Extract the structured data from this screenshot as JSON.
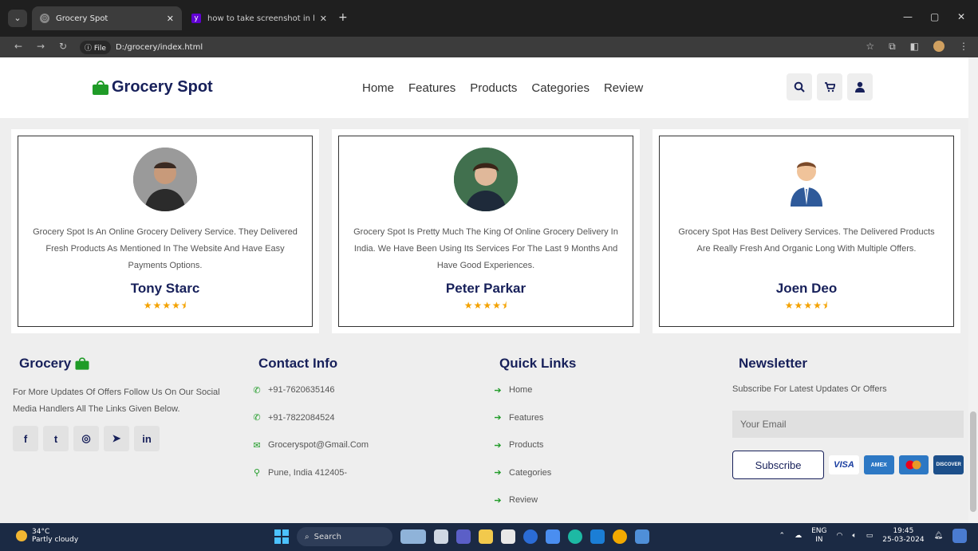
{
  "browser": {
    "tabs": [
      {
        "title": "Grocery Spot",
        "active": true
      },
      {
        "title": "how to take screenshot in lapto",
        "active": false
      }
    ],
    "file_chip": "File",
    "url": "D:/grocery/index.html"
  },
  "header": {
    "logo": "Grocery Spot",
    "nav": [
      "Home",
      "Features",
      "Products",
      "Categories",
      "Review"
    ]
  },
  "reviews": [
    {
      "text": "Grocery Spot Is An Online Grocery Delivery Service. They Delivered Fresh Products As Mentioned In The Website And Have Easy Payments Options.",
      "name": "Tony Starc",
      "rating": 4.5
    },
    {
      "text": "Grocery Spot Is Pretty Much The King Of Online Grocery Delivery In India. We Have Been Using Its Services For The Last 9 Months And Have Good Experiences.",
      "name": "Peter Parkar",
      "rating": 4.5
    },
    {
      "text": "Grocery Spot Has Best Delivery Services. The Delivered Products Are Really Fresh And Organic Long With Multiple Offers.",
      "name": "Joen Deo",
      "rating": 4.5
    }
  ],
  "footer": {
    "brand": {
      "title": "Grocery",
      "text": "For More Updates Of Offers Follow Us On Our Social Media Handlers All The Links Given Below.",
      "socials": [
        "f",
        "t",
        "◎",
        "➤",
        "in"
      ]
    },
    "contact": {
      "title": "Contact Info",
      "items": [
        "+91-7620635146",
        "+91-7822084524",
        "Groceryspot@Gmail.Com",
        "Pune, India 412405-"
      ]
    },
    "quick_links": {
      "title": "Quick Links",
      "items": [
        "Home",
        "Features",
        "Products",
        "Categories",
        "Review"
      ]
    },
    "newsletter": {
      "title": "Newsletter",
      "text": "Subscribe For Latest Updates Or Offers",
      "placeholder": "Your Email",
      "button": "Subscribe",
      "cards": [
        "VISA",
        "AMEX",
        "MC",
        "DISCOVER"
      ]
    }
  },
  "taskbar": {
    "temp": "34°C",
    "weather": "Partly cloudy",
    "search": "Search",
    "lang_top": "ENG",
    "lang_bottom": "IN",
    "time": "19:45",
    "date": "25-03-2024"
  },
  "colors": {
    "brand_navy": "#17205a",
    "brand_green": "#1f9b27",
    "star": "#f4a200"
  }
}
